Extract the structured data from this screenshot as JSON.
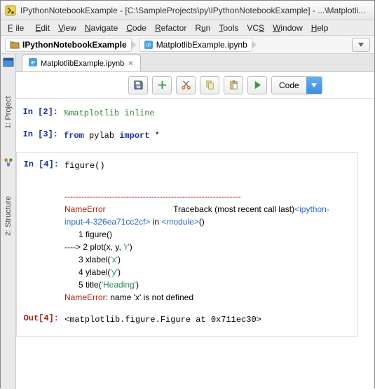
{
  "window": {
    "title": "IPythonNotebookExample - [C:\\SampleProjects\\py\\IPythonNotebookExample] - ...\\Matplotli..."
  },
  "menubar": {
    "file": "File",
    "edit": "Edit",
    "view": "View",
    "navigate": "Navigate",
    "code": "Code",
    "refactor": "Refactor",
    "run": "Run",
    "tools": "Tools",
    "vcs": "VCS",
    "window": "Window",
    "help": "Help"
  },
  "breadcrumb": {
    "project": "IPythonNotebookExample",
    "file": "MatplotlibExample.ipynb"
  },
  "sidetabs": {
    "project_num": "1:",
    "project_label": "Project",
    "structure_num": "2:",
    "structure_label": "Structure"
  },
  "tab": {
    "label": "MatplotlibExample.ipynb",
    "close": "×"
  },
  "toolbar": {
    "celltype": "Code"
  },
  "cells": {
    "c2": {
      "prompt": "In [2]:",
      "code": "%matplotlib inline"
    },
    "c3": {
      "prompt": "In [3]:",
      "kw_from": "from",
      "mod": " pylab ",
      "kw_import": "import",
      "star": " *"
    },
    "c4": {
      "prompt": "In [4]:",
      "code": "figure()",
      "hr": "---------------------------------------------------------------",
      "err_name": "NameError",
      "tb_label": "Traceback (most recent call last)",
      "ipy_in": "<ipython-input-4-326ea71cc2cf>",
      "in_word": " in ",
      "module": "<module>",
      "paren": "()",
      "l1": "1 figure()",
      "l2a": "----> 2 plot(x, y, ",
      "l2b": "'r'",
      "l2c": ")",
      "l3a": "3 xlabel(",
      "l3b": "'x'",
      "l3c": ")",
      "l4a": "4 ylabel(",
      "l4b": "'y'",
      "l4c": ")",
      "l5a": "5 title(",
      "l5b": "'Heading'",
      "l5c": ")",
      "final": ": name 'x' is not defined"
    },
    "out4": {
      "prompt": "Out[4]:",
      "text": "<matplotlib.figure.Figure at 0x711ec30>"
    }
  }
}
